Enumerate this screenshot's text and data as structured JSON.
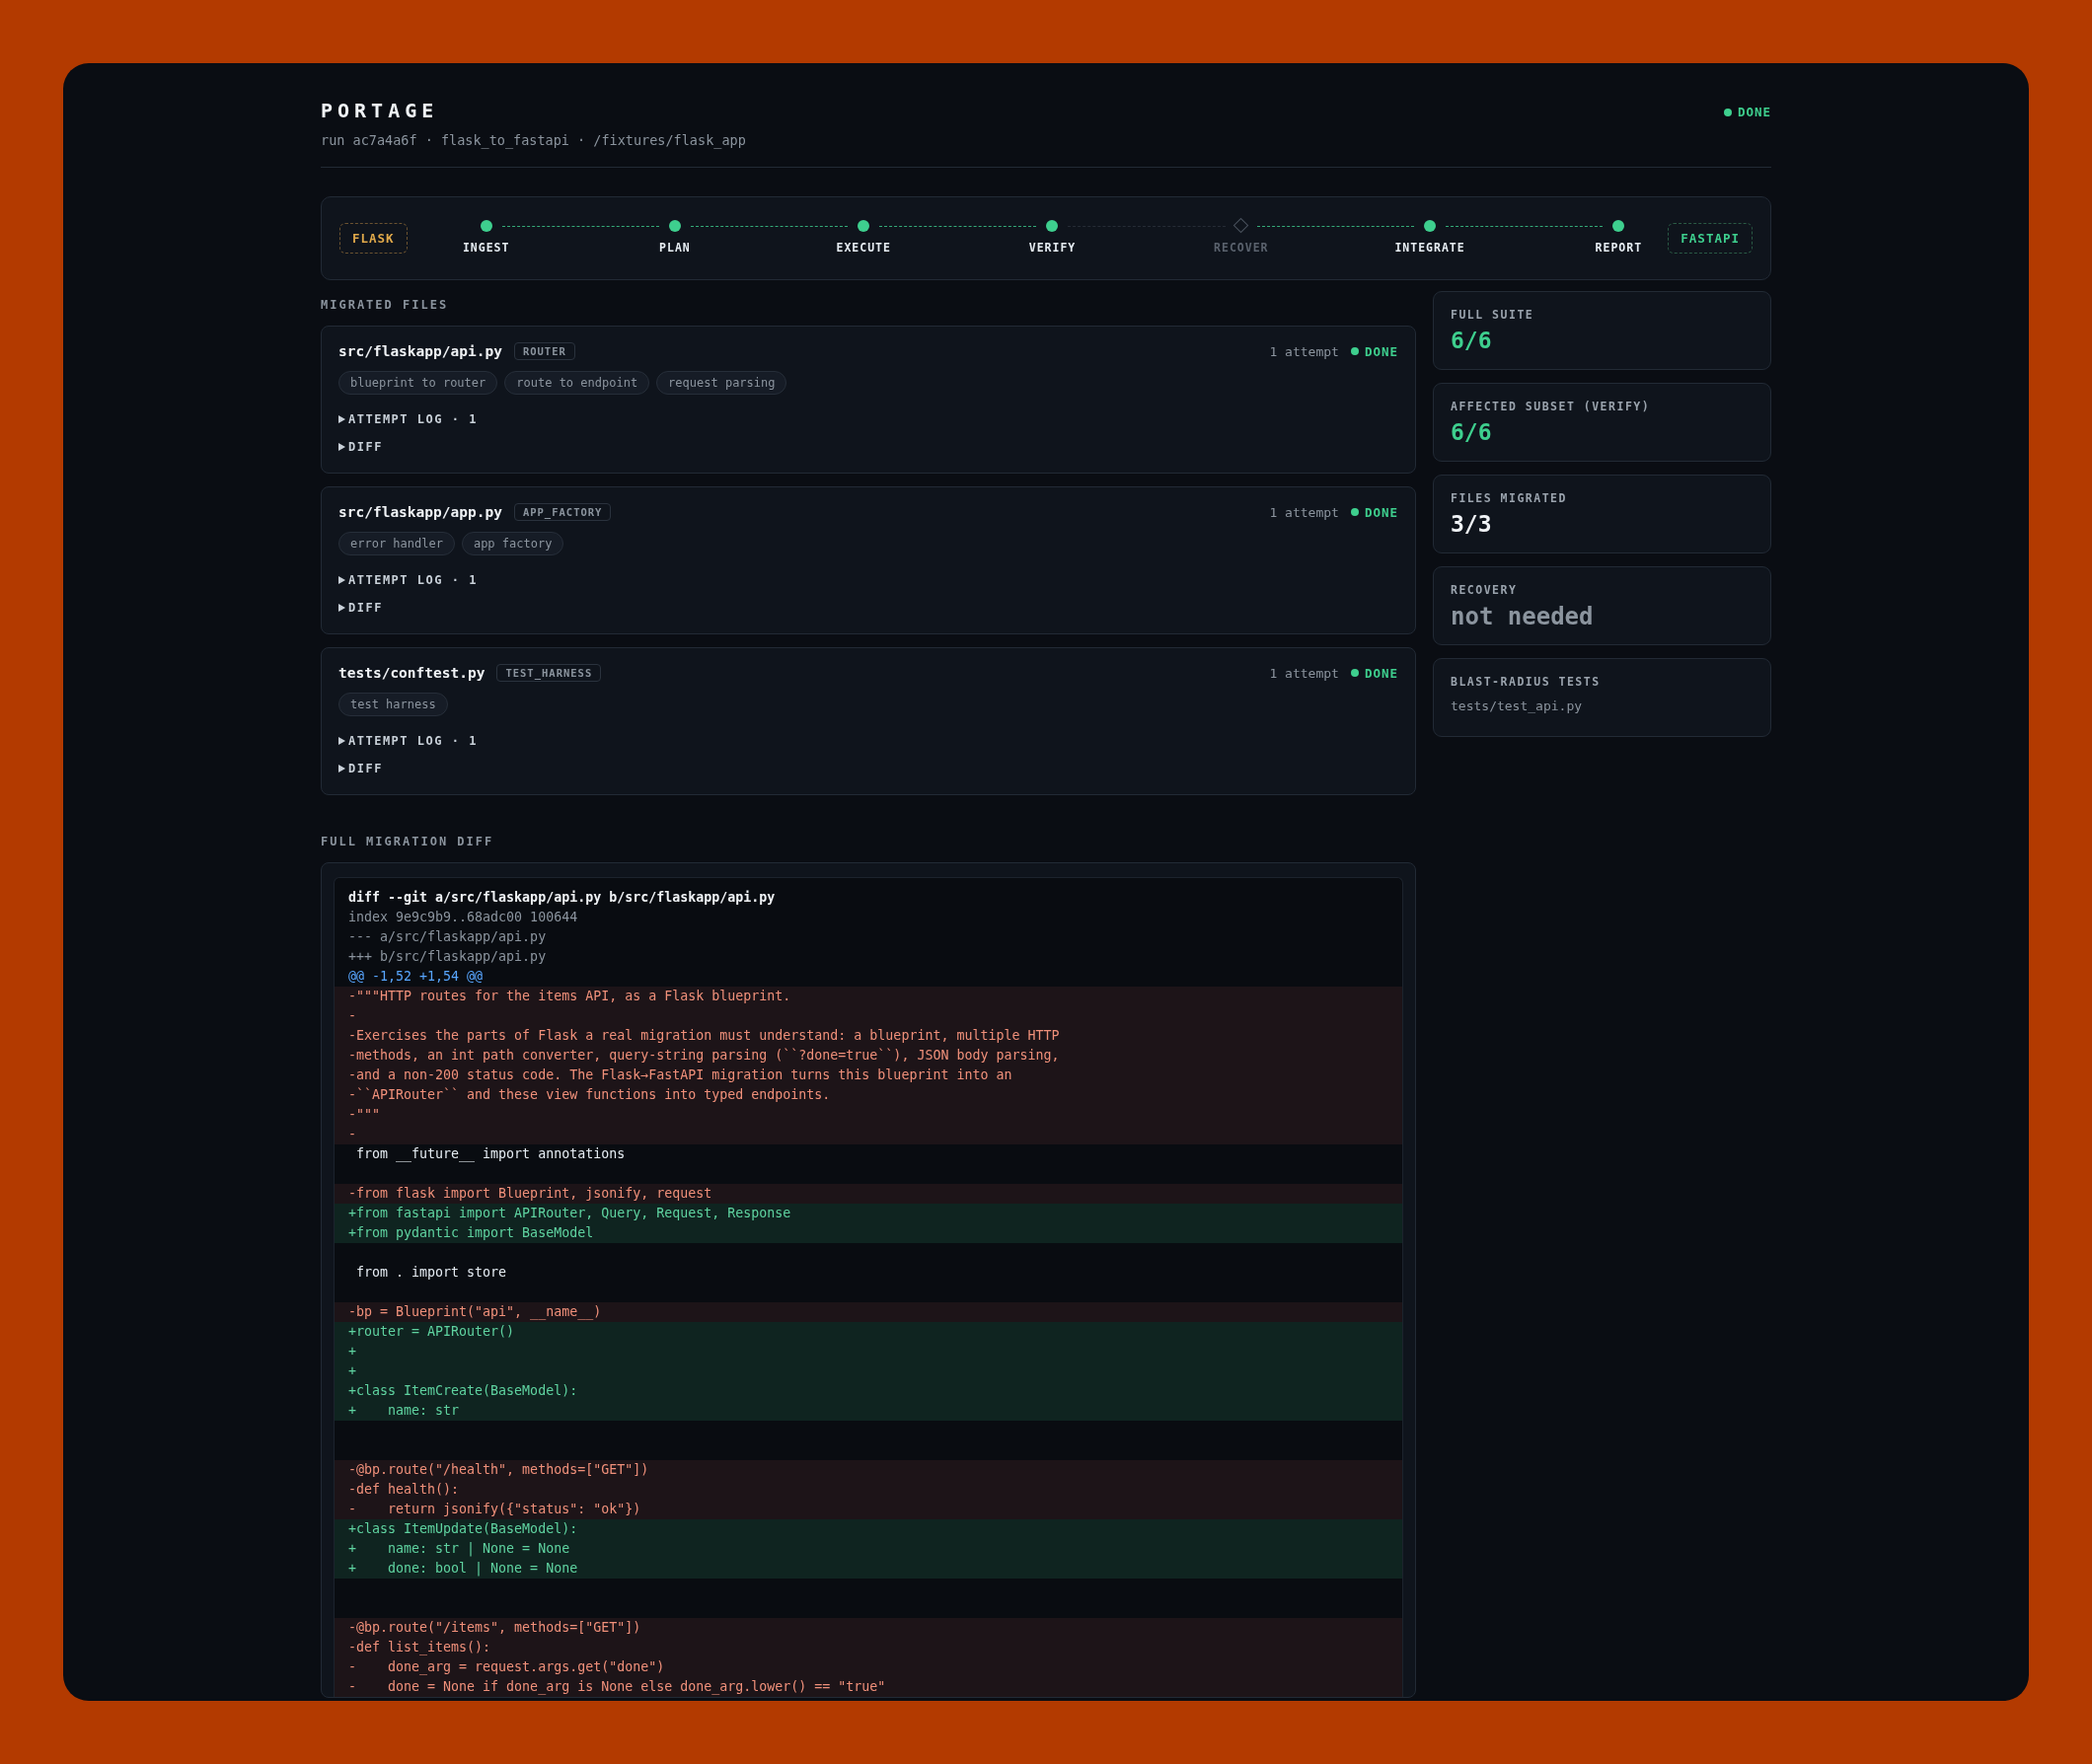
{
  "header": {
    "title": "PORTAGE",
    "subtitle": "run ac7a4a6f · flask_to_fastapi · /fixtures/flask_app",
    "status": {
      "label": "DONE",
      "kind": "done"
    }
  },
  "pipeline": {
    "source": "FLASK",
    "target": "FASTAPI",
    "stages": [
      {
        "label": "INGEST",
        "done": true
      },
      {
        "label": "PLAN",
        "done": true
      },
      {
        "label": "EXECUTE",
        "done": true
      },
      {
        "label": "VERIFY",
        "done": true
      },
      {
        "label": "RECOVER",
        "done": false
      },
      {
        "label": "INTEGRATE",
        "done": true
      },
      {
        "label": "REPORT",
        "done": true
      }
    ]
  },
  "migrated_files": {
    "title": "MIGRATED FILES",
    "files": [
      {
        "path": "src/flaskapp/api.py",
        "tag": "ROUTER",
        "attempts": "1 attempt",
        "status": {
          "label": "DONE",
          "kind": "done"
        },
        "chips": [
          "blueprint to router",
          "route to endpoint",
          "request parsing"
        ],
        "sections": [
          {
            "label": "ATTEMPT LOG · 1",
            "expanded": false
          },
          {
            "label": "DIFF",
            "expanded": false
          }
        ]
      },
      {
        "path": "src/flaskapp/app.py",
        "tag": "APP_FACTORY",
        "attempts": "1 attempt",
        "status": {
          "label": "DONE",
          "kind": "done"
        },
        "chips": [
          "error handler",
          "app factory"
        ],
        "sections": [
          {
            "label": "ATTEMPT LOG · 1",
            "expanded": false
          },
          {
            "label": "DIFF",
            "expanded": false
          }
        ]
      },
      {
        "path": "tests/conftest.py",
        "tag": "TEST_HARNESS",
        "attempts": "1 attempt",
        "status": {
          "label": "DONE",
          "kind": "done"
        },
        "chips": [
          "test harness"
        ],
        "sections": [
          {
            "label": "ATTEMPT LOG · 1",
            "expanded": false
          },
          {
            "label": "DIFF",
            "expanded": false
          }
        ]
      }
    ]
  },
  "stats": [
    {
      "label": "FULL SUITE",
      "value": "6/6",
      "kind": "pass"
    },
    {
      "label": "AFFECTED SUBSET (VERIFY)",
      "value": "6/6",
      "kind": "pass"
    },
    {
      "label": "FILES MIGRATED",
      "value": "3/3",
      "kind": "plain"
    },
    {
      "label": "RECOVERY",
      "value": "not needed",
      "kind": "muted"
    },
    {
      "label": "BLAST-RADIUS TESTS",
      "value": "tests/test_api.py",
      "kind": "list"
    }
  ],
  "full_diff": {
    "title": "FULL MIGRATION DIFF",
    "lines": [
      {
        "kind": "header",
        "text": "diff --git a/src/flaskapp/api.py b/src/flaskapp/api.py"
      },
      {
        "kind": "meta",
        "text": "index 9e9c9b9..68adc00 100644"
      },
      {
        "kind": "meta",
        "text": "--- a/src/flaskapp/api.py"
      },
      {
        "kind": "meta",
        "text": "+++ b/src/flaskapp/api.py"
      },
      {
        "kind": "hunk",
        "text": "@@ -1,52 +1,54 @@"
      },
      {
        "kind": "del",
        "text": "-\"\"\"HTTP routes for the items API, as a Flask blueprint."
      },
      {
        "kind": "del",
        "text": "-"
      },
      {
        "kind": "del",
        "text": "-Exercises the parts of Flask a real migration must understand: a blueprint, multiple HTTP"
      },
      {
        "kind": "del",
        "text": "-methods, an int path converter, query-string parsing (``?done=true``), JSON body parsing,"
      },
      {
        "kind": "del",
        "text": "-and a non-200 status code. The Flask→FastAPI migration turns this blueprint into an"
      },
      {
        "kind": "del",
        "text": "-``APIRouter`` and these view functions into typed endpoints."
      },
      {
        "kind": "del",
        "text": "-\"\"\""
      },
      {
        "kind": "del",
        "text": "-"
      },
      {
        "kind": "ctx",
        "text": " from __future__ import annotations"
      },
      {
        "kind": "blank"
      },
      {
        "kind": "del",
        "text": "-from flask import Blueprint, jsonify, request"
      },
      {
        "kind": "add",
        "text": "+from fastapi import APIRouter, Query, Request, Response"
      },
      {
        "kind": "add",
        "text": "+from pydantic import BaseModel"
      },
      {
        "kind": "blank"
      },
      {
        "kind": "ctx",
        "text": " from . import store"
      },
      {
        "kind": "blank"
      },
      {
        "kind": "del",
        "text": "-bp = Blueprint(\"api\", __name__)"
      },
      {
        "kind": "add",
        "text": "+router = APIRouter()"
      },
      {
        "kind": "add",
        "text": "+"
      },
      {
        "kind": "add",
        "text": "+"
      },
      {
        "kind": "add",
        "text": "+class ItemCreate(BaseModel):"
      },
      {
        "kind": "add",
        "text": "+    name: str"
      },
      {
        "kind": "blank"
      },
      {
        "kind": "blank"
      },
      {
        "kind": "del",
        "text": "-@bp.route(\"/health\", methods=[\"GET\"])"
      },
      {
        "kind": "del",
        "text": "-def health():"
      },
      {
        "kind": "del",
        "text": "-    return jsonify({\"status\": \"ok\"})"
      },
      {
        "kind": "add",
        "text": "+class ItemUpdate(BaseModel):"
      },
      {
        "kind": "add",
        "text": "+    name: str | None = None"
      },
      {
        "kind": "add",
        "text": "+    done: bool | None = None"
      },
      {
        "kind": "blank"
      },
      {
        "kind": "blank"
      },
      {
        "kind": "del",
        "text": "-@bp.route(\"/items\", methods=[\"GET\"])"
      },
      {
        "kind": "del",
        "text": "-def list_items():"
      },
      {
        "kind": "del",
        "text": "-    done_arg = request.args.get(\"done\")"
      },
      {
        "kind": "del",
        "text": "-    done = None if done_arg is None else done_arg.lower() == \"true\""
      }
    ]
  }
}
